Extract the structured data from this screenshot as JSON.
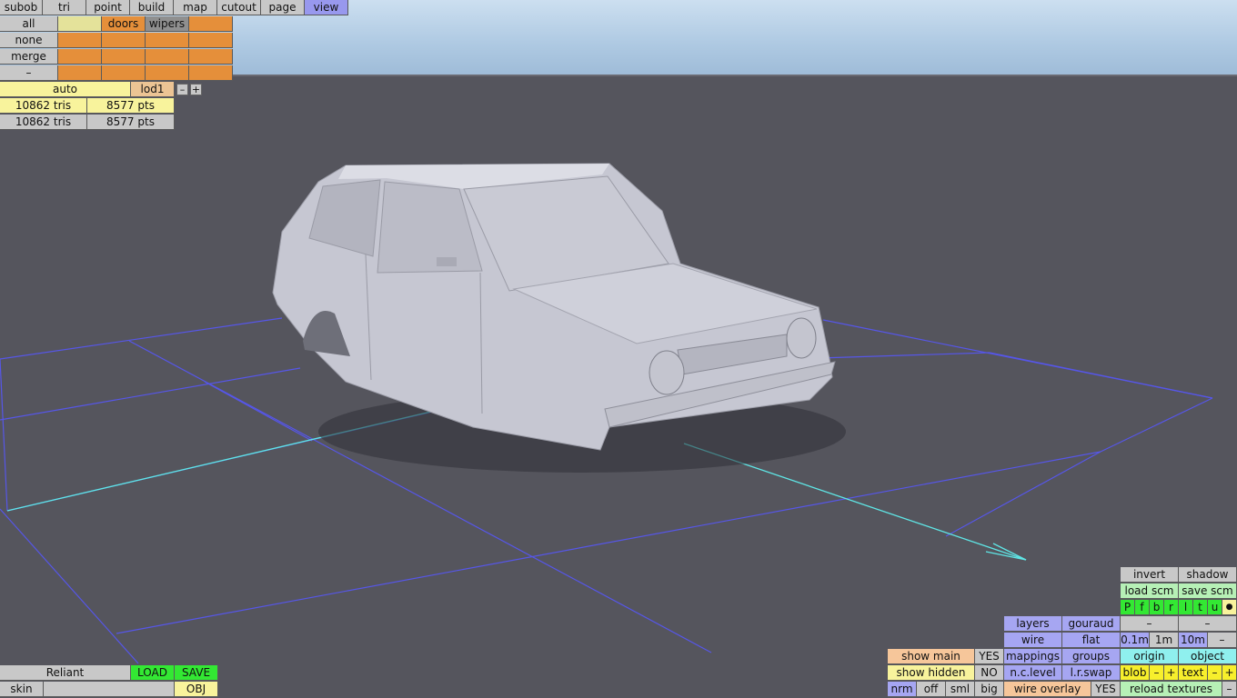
{
  "menu": {
    "items": [
      "subob",
      "tri",
      "point",
      "build",
      "map",
      "cutout",
      "page",
      "view"
    ],
    "active": "view"
  },
  "groups": {
    "all": "all",
    "none": "none",
    "merge": "merge",
    "minus": "–",
    "doors": "doors",
    "wipers": "wipers"
  },
  "lod": {
    "auto": "auto",
    "lod1": "lod1",
    "minus": "–",
    "plus": "+"
  },
  "stats": [
    {
      "tris": "10862 tris",
      "pts": "8577 pts"
    },
    {
      "tris": "10862 tris",
      "pts": "8577 pts"
    }
  ],
  "model": {
    "name": "Reliant",
    "load": "LOAD",
    "save": "SAVE",
    "skin": "skin",
    "format": "OBJ"
  },
  "view_panel": {
    "show_main": "show main",
    "show_main_value": "YES",
    "show_hidden": "show hidden",
    "show_hidden_value": "NO",
    "nrm": "nrm",
    "off": "off",
    "sml": "sml",
    "big": "big",
    "layers": "layers",
    "gouraud": "gouraud",
    "wire": "wire",
    "flat": "flat",
    "mappings": "mappings",
    "groups": "groups",
    "nc_level": "n.c.level",
    "lr_swap": "l.r.swap",
    "wire_overlay": "wire overlay",
    "wire_overlay_value": "YES",
    "invert": "invert",
    "shadow": "shadow",
    "load_scm": "load scm",
    "save_scm": "save scm",
    "channels": [
      "P",
      "f",
      "b",
      "r",
      "l",
      "t",
      "u"
    ],
    "dot": "●",
    "dash": "–",
    "grid_01": "0.1m",
    "grid_1": "1m",
    "grid_10": "10m",
    "origin": "origin",
    "object": "object",
    "blob": "blob",
    "text": "text",
    "minus": "–",
    "plus": "+",
    "reload_textures": "reload textures"
  }
}
